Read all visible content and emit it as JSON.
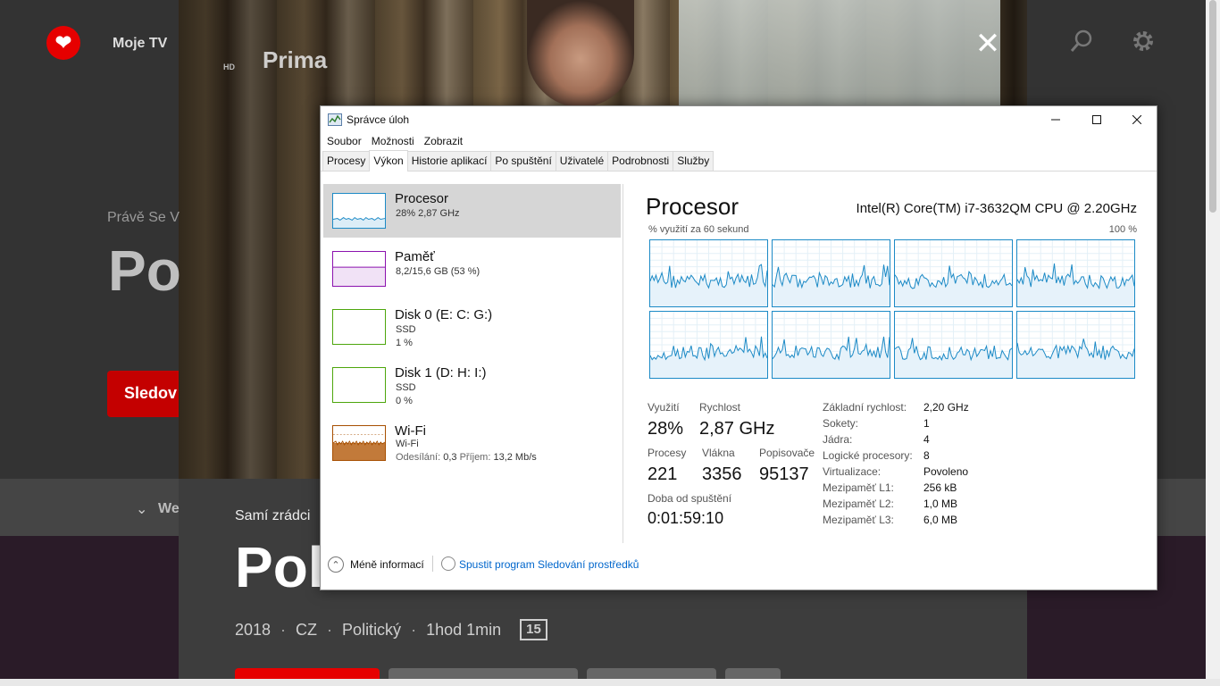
{
  "tv_app": {
    "nav_title": "Moje TV",
    "channel_logo": "Prima",
    "channel_logo_hd": "HD",
    "close_label": "✕",
    "now_playing_label": "Právě Se V",
    "title_left_fragment": "Po",
    "watch_button_fragment": "Sledov",
    "section_fragment": "We",
    "subtitle": "Samí zrádci",
    "title_fragment": "Pol",
    "meta": {
      "year": "2018",
      "country": "CZ",
      "genre": "Politický",
      "duration": "1hod 1min",
      "rating": "15"
    },
    "brand_color": "#e60000"
  },
  "task_manager": {
    "window_title": "Správce úloh",
    "menu": [
      "Soubor",
      "Možnosti",
      "Zobrazit"
    ],
    "tabs": [
      "Procesy",
      "Výkon",
      "Historie aplikací",
      "Po spuštění",
      "Uživatelé",
      "Podrobnosti",
      "Služby"
    ],
    "active_tab": "Výkon",
    "sidebar": [
      {
        "name": "Procesor",
        "line1": "28% 2,87 GHz",
        "line2": "",
        "color": "#1c8ac6",
        "selected": true
      },
      {
        "name": "Paměť",
        "line1": "8,2/15,6 GB (53 %)",
        "line2": "",
        "color": "#8b12ae",
        "selected": false
      },
      {
        "name": "Disk 0 (E: C: G:)",
        "line1": "SSD",
        "line2": "1 %",
        "color": "#4da60c",
        "selected": false
      },
      {
        "name": "Disk 1 (D: H: I:)",
        "line1": "SSD",
        "line2": "0 %",
        "color": "#4da60c",
        "selected": false
      },
      {
        "name": "Wi-Fi",
        "line1": "Wi-Fi",
        "line2_label_send": "Odesílání:",
        "line2_send": "0,3",
        "line2_label_recv": "Příjem:",
        "line2_recv": "13,2 Mb/s",
        "color": "#a74f01",
        "selected": false
      }
    ],
    "main": {
      "title": "Procesor",
      "cpu_name": "Intel(R) Core(TM) i7-3632QM CPU @ 2.20GHz",
      "graph_label": "% využití za 60 sekund",
      "graph_max": "100 %",
      "stats": {
        "utilization_label": "Využití",
        "utilization": "28%",
        "speed_label": "Rychlost",
        "speed": "2,87 GHz",
        "processes_label": "Procesy",
        "processes": "221",
        "threads_label": "Vlákna",
        "threads": "3356",
        "handles_label": "Popisovače",
        "handles": "95137",
        "uptime_label": "Doba od spuštění",
        "uptime": "0:01:59:10"
      },
      "info": [
        {
          "label": "Základní rychlost:",
          "value": "2,20 GHz"
        },
        {
          "label": "Sokety:",
          "value": "1"
        },
        {
          "label": "Jádra:",
          "value": "4"
        },
        {
          "label": "Logické procesory:",
          "value": "8"
        },
        {
          "label": "Virtualizace:",
          "value": "Povoleno"
        },
        {
          "label": "Mezipaměť L1:",
          "value": "256 kB"
        },
        {
          "label": "Mezipaměť L2:",
          "value": "1,0 MB"
        },
        {
          "label": "Mezipaměť L3:",
          "value": "6,0 MB"
        }
      ],
      "graph_color": "#1c8ac6"
    },
    "footer": {
      "fewer_details": "Méně informací",
      "resource_monitor": "Spustit program Sledování prostředků"
    }
  }
}
